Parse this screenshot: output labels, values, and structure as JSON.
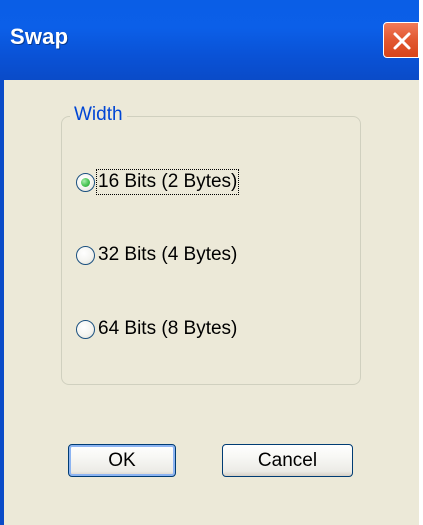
{
  "window": {
    "title": "Swap"
  },
  "group": {
    "label": "Width",
    "options": [
      {
        "label": "16 Bits (2 Bytes)",
        "checked": true
      },
      {
        "label": "32 Bits (4 Bytes)",
        "checked": false
      },
      {
        "label": "64 Bits (8 Bytes)",
        "checked": false
      }
    ]
  },
  "buttons": {
    "ok_label": "OK",
    "cancel_label": "Cancel"
  },
  "colors": {
    "titlebar": "#0a5ee6",
    "dialog_background": "#ece9d8",
    "group_label": "#0046d5",
    "close_button": "#e35a33",
    "radio_selected": "#4fc85a"
  },
  "icons": {
    "close": "close-icon"
  }
}
